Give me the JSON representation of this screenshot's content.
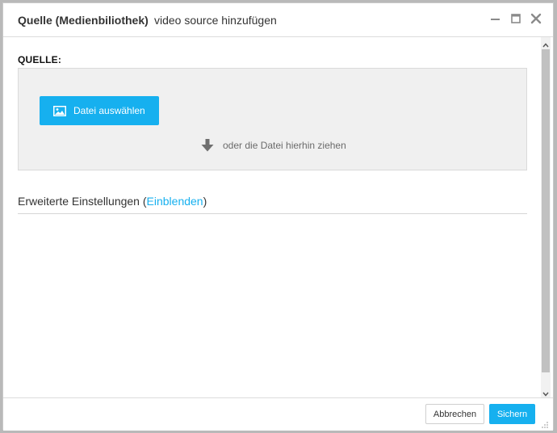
{
  "dialog": {
    "title": "Quelle (Medienbiliothek)",
    "subtitle": "video source hinzufügen"
  },
  "source": {
    "label": "QUELLE:",
    "choose_button": "Datei auswählen",
    "drop_hint": "oder die Datei hierhin ziehen"
  },
  "advanced": {
    "text": "Erweiterte Einstellungen (",
    "link": "Einblenden",
    "close": ")"
  },
  "footer": {
    "cancel_label": "Abbrechen",
    "save_label": "Sichern"
  },
  "icons": {
    "minimize": "minimize-icon",
    "maximize": "maximize-icon",
    "close": "close-icon",
    "image": "image-icon",
    "arrow": "arrow-down-icon"
  },
  "colors": {
    "accent": "#16b0ef",
    "dropzone_bg": "#f0f0f0"
  }
}
